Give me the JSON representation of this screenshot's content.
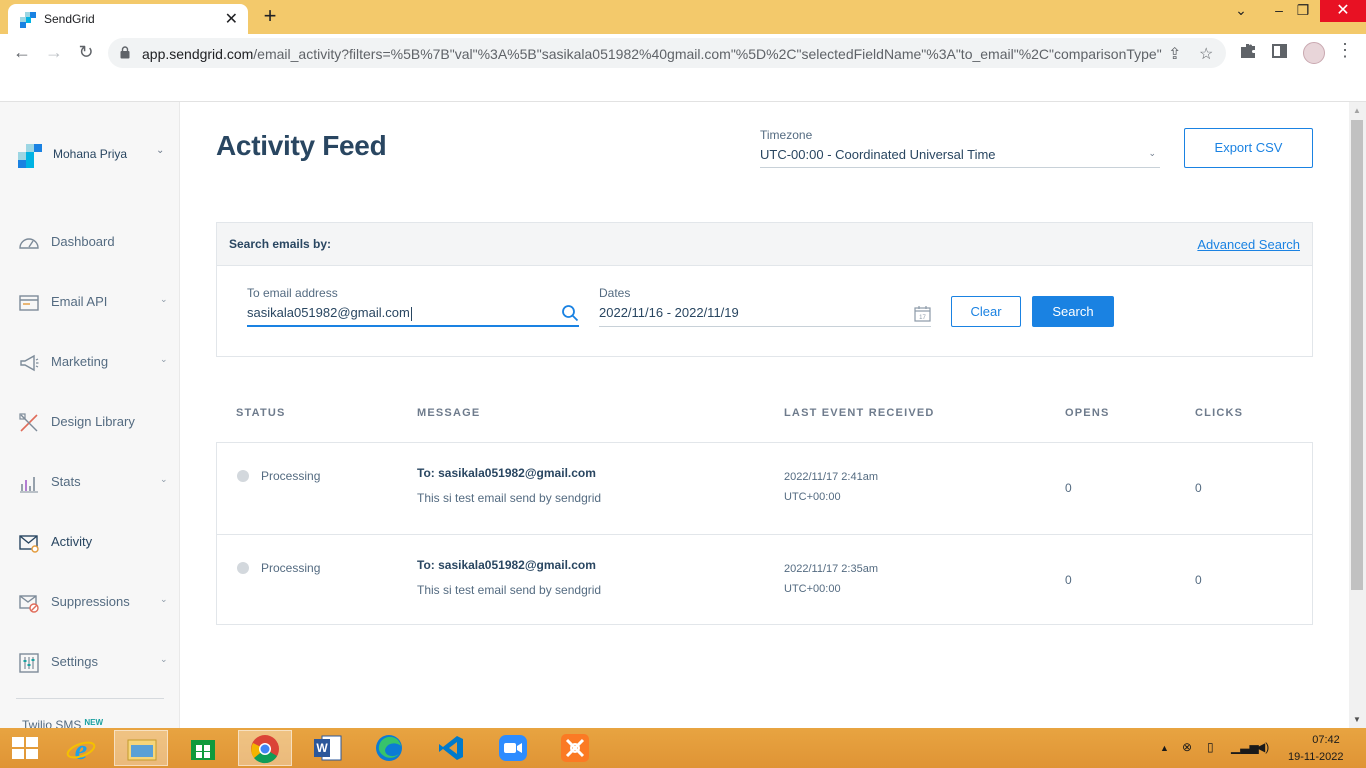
{
  "browser": {
    "tab_title": "SendGrid",
    "tab_close": "✕",
    "new_tab": "+",
    "url_host": "app.sendgrid.com",
    "url_rest": "/email_activity?filters=%5B%7B\"val\"%3A%5B\"sasikala051982%40gmail.com\"%5D%2C\"selectedFieldName\"%3A\"to_email\"%2C\"comparisonType\"..."
  },
  "sidebar": {
    "account_name": "Mohana Priya",
    "items": [
      {
        "label": "Dashboard",
        "icon": "dashboard-icon",
        "has_chevron": false
      },
      {
        "label": "Email API",
        "icon": "email-api-icon",
        "has_chevron": true
      },
      {
        "label": "Marketing",
        "icon": "megaphone-icon",
        "has_chevron": true
      },
      {
        "label": "Design Library",
        "icon": "design-library-icon",
        "has_chevron": false
      },
      {
        "label": "Stats",
        "icon": "stats-icon",
        "has_chevron": true
      },
      {
        "label": "Activity",
        "icon": "activity-icon",
        "has_chevron": false,
        "active": true
      },
      {
        "label": "Suppressions",
        "icon": "suppressions-icon",
        "has_chevron": true
      },
      {
        "label": "Settings",
        "icon": "settings-icon",
        "has_chevron": true
      }
    ],
    "twilio_label": "Twilio SMS",
    "twilio_badge": "NEW"
  },
  "header": {
    "title": "Activity Feed",
    "timezone_label": "Timezone",
    "timezone_value": "UTC-00:00 - Coordinated Universal Time",
    "export_label": "Export CSV"
  },
  "search": {
    "heading": "Search emails by:",
    "advanced_label": "Advanced Search",
    "email_label": "To email address",
    "email_value": "sasikala051982@gmail.com",
    "dates_label": "Dates",
    "dates_value": "2022/11/16 - 2022/11/19",
    "calendar_day": "17",
    "clear_label": "Clear",
    "search_label": "Search"
  },
  "table": {
    "columns": [
      "STATUS",
      "MESSAGE",
      "LAST EVENT RECEIVED",
      "OPENS",
      "CLICKS"
    ],
    "rows": [
      {
        "status": "Processing",
        "to": "To: sasikala051982@gmail.com",
        "subject": "This si test email send by sendgrid",
        "event_time": "2022/11/17 2:41am",
        "event_tz": "UTC+00:00",
        "opens": "0",
        "clicks": "0"
      },
      {
        "status": "Processing",
        "to": "To: sasikala051982@gmail.com",
        "subject": "This si test email send by sendgrid",
        "event_time": "2022/11/17 2:35am",
        "event_tz": "UTC+00:00",
        "opens": "0",
        "clicks": "0"
      }
    ]
  },
  "taskbar": {
    "time": "07:42",
    "date": "19-11-2022"
  },
  "colors": {
    "accent": "#1a82e2",
    "text_dark": "#294661",
    "titlebar": "#f3c96b",
    "taskbar": "#e39b3c",
    "close_red": "#e81123"
  }
}
